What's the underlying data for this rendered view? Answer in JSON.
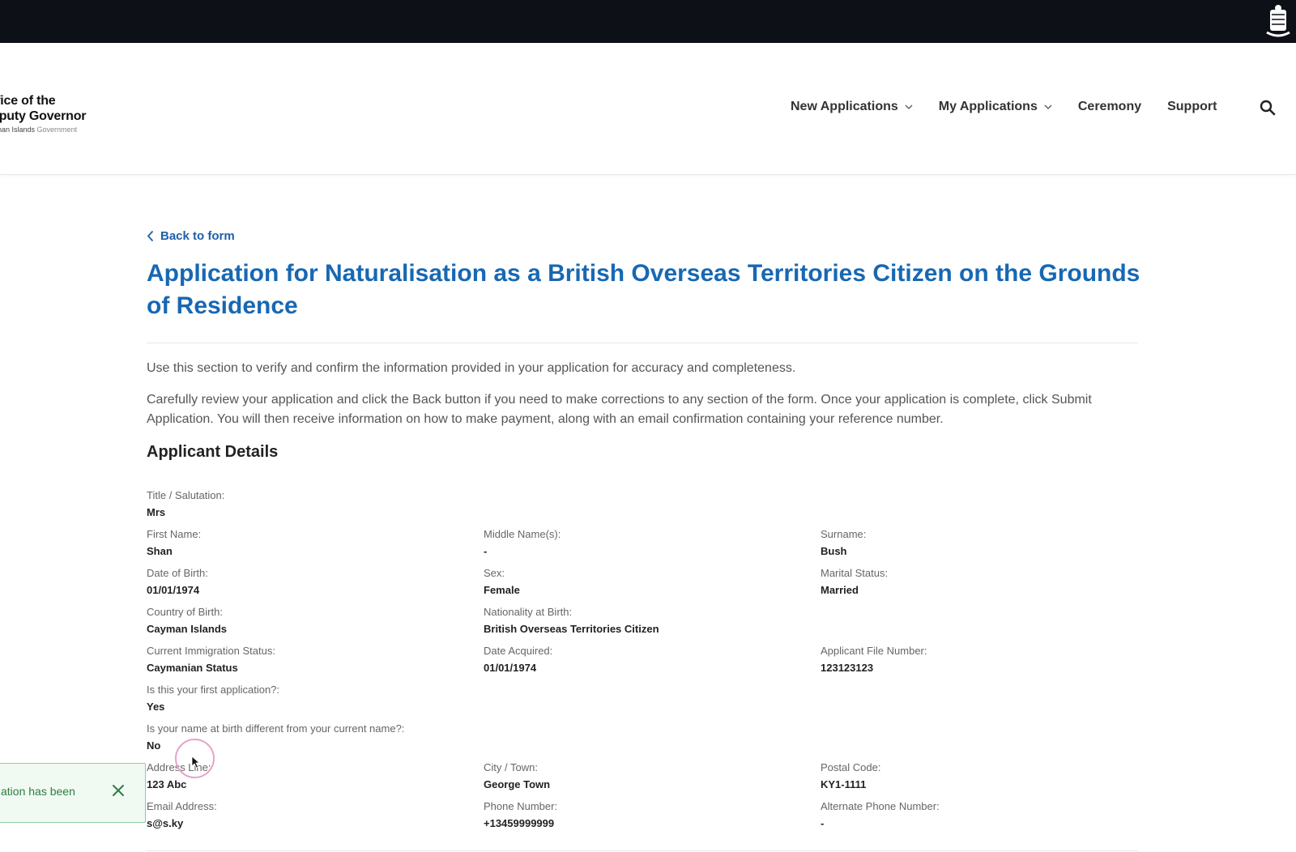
{
  "header": {
    "logo_line1": "ffice of the",
    "logo_line2": "eputy Governor",
    "logo_line3": "yman Islands",
    "logo_line3_gov": "Government"
  },
  "nav": {
    "new_applications": "New Applications",
    "my_applications": "My Applications",
    "ceremony": "Ceremony",
    "support": "Support"
  },
  "page": {
    "back_label": "Back to form",
    "title": "Application for Naturalisation as a British Overseas Territories Citizen on the Grounds of Residence",
    "intro1": "Use this section to verify and confirm the information provided in your application for accuracy and completeness.",
    "intro2": "Carefully review your application and click the Back button if you need to make corrections to any section of the form. Once your application is complete, click Submit Application. You will then receive information on how to make payment, along with an email confirmation containing your reference number.",
    "section_title": "Applicant Details"
  },
  "fields": {
    "title_salutation": {
      "label": "Title / Salutation:",
      "value": "Mrs"
    },
    "first_name": {
      "label": "First Name:",
      "value": "Shan"
    },
    "middle_names": {
      "label": "Middle Name(s):",
      "value": "-"
    },
    "surname": {
      "label": "Surname:",
      "value": "Bush"
    },
    "dob": {
      "label": "Date of Birth:",
      "value": "01/01/1974"
    },
    "sex": {
      "label": "Sex:",
      "value": "Female"
    },
    "marital_status": {
      "label": "Marital Status:",
      "value": "Married"
    },
    "country_of_birth": {
      "label": "Country of Birth:",
      "value": "Cayman Islands"
    },
    "nationality_at_birth": {
      "label": "Nationality at Birth:",
      "value": "British Overseas Territories Citizen"
    },
    "immigration_status": {
      "label": "Current Immigration Status:",
      "value": "Caymanian Status"
    },
    "date_acquired": {
      "label": "Date Acquired:",
      "value": "01/01/1974"
    },
    "applicant_file_number": {
      "label": "Applicant File Number:",
      "value": "123123123"
    },
    "first_application": {
      "label": "Is this your first application?:",
      "value": "Yes"
    },
    "name_at_birth_different": {
      "label": "Is your name at birth different from your current name?:",
      "value": "No"
    },
    "address_line": {
      "label": "Address Line:",
      "value": "123 Abc"
    },
    "city_town": {
      "label": "City / Town:",
      "value": "George Town"
    },
    "postal_code": {
      "label": "Postal Code:",
      "value": "KY1-1111"
    },
    "email": {
      "label": "Email Address:",
      "value": "s@s.ky"
    },
    "phone": {
      "label": "Phone Number:",
      "value": "+13459999999"
    },
    "alt_phone": {
      "label": "Alternate Phone Number:",
      "value": "-"
    }
  },
  "toast": {
    "message": "ation has been"
  },
  "colors": {
    "brand_blue": "#1768b3",
    "link_blue": "#1f5fa8",
    "topbar": "#0d1117",
    "toast_bg": "#f0f9f2",
    "toast_text": "#2e7d43"
  }
}
